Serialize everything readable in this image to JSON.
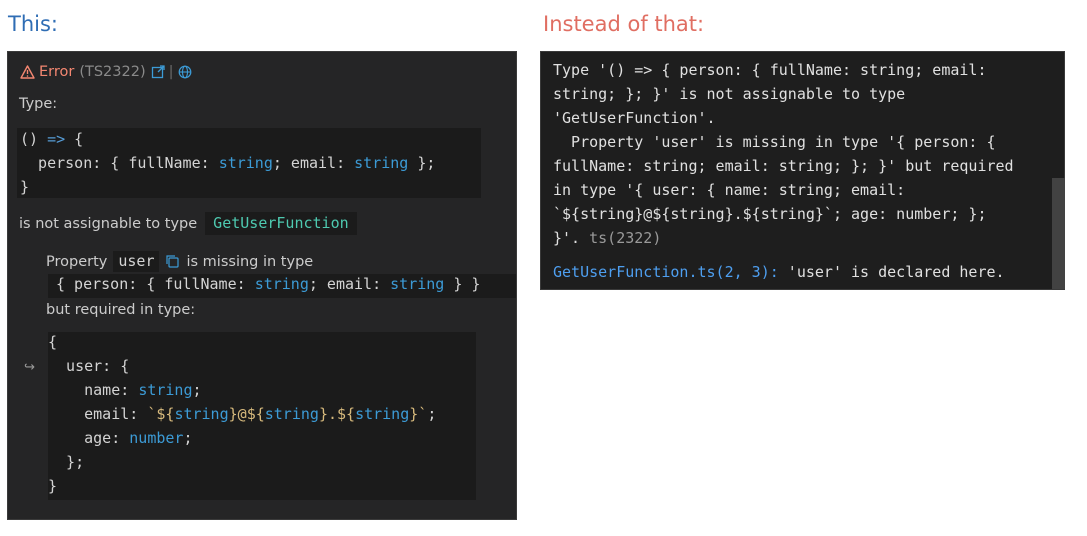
{
  "captions": {
    "left": "This:",
    "right": "Instead of that:"
  },
  "left_panel": {
    "error_label": "Error",
    "error_code": "(TS2322)",
    "separator": "|",
    "type_label": "Type:",
    "code_source": {
      "line1_a": "()",
      "line1_arrow": "=>",
      "line1_b": " {",
      "line2_a": "  person: { fullName: ",
      "line2_string1": "string",
      "line2_b": "; email: ",
      "line2_string2": "string",
      "line2_c": " };",
      "line3": "}"
    },
    "not_assignable_text": "is not assignable to type",
    "target_type": "GetUserFunction",
    "property_prefix": "Property",
    "property_name": "user",
    "property_suffix": "is missing in type",
    "inline_type": {
      "a": "{ person: { fullName: ",
      "string1": "string",
      "b": "; email: ",
      "string2": "string",
      "c": " } }"
    },
    "but_required_text": "but required in type:",
    "wrap_arrow": "↪",
    "required_type": {
      "l1": "{",
      "l2": "  user: {",
      "l3_a": "    name: ",
      "l3_type": "string",
      "l3_b": ";",
      "l4_a": "    email: ",
      "l4_tick1": "`",
      "l4_t1": "${string}",
      "l4_at": "@",
      "l4_t2": "${string}",
      "l4_dot": ".",
      "l4_t3": "${string}",
      "l4_tick2": "`",
      "l4_end": ";",
      "l5_a": "    age: ",
      "l5_type": "number",
      "l5_b": ";",
      "l6": "  };",
      "l7": "}"
    }
  },
  "right_panel": {
    "lines": [
      "Type '() => { person: { fullName: string; email:",
      "string; }; }' is not assignable to type",
      "'GetUserFunction'.",
      "  Property 'user' is missing in type '{ person: {",
      "fullName: string; email: string; }; }' but required",
      "in type '{ user: { name: string; email:",
      "`${string}@${string}.${string}`; age: number; };"
    ],
    "last_line": "}'.",
    "ts_code": "ts(2322)",
    "declared_link": "GetUserFunction.ts(2, 3):",
    "declared_text": " 'user' is declared here."
  }
}
